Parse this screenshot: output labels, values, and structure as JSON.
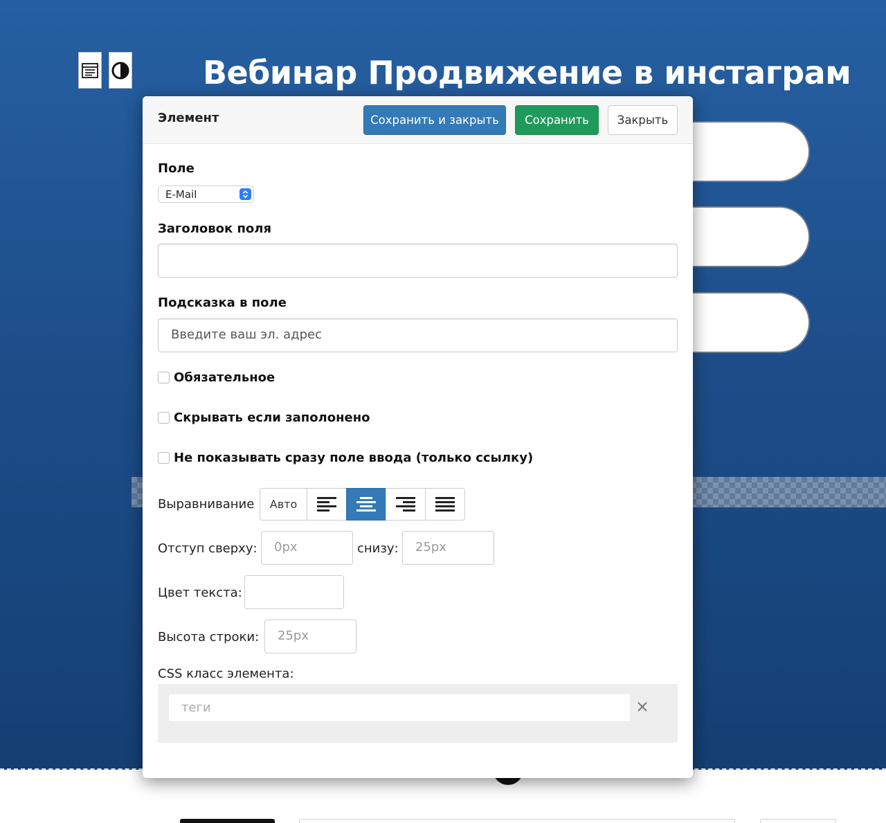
{
  "page": {
    "title": "Вебинар Продвижение в инстаграм"
  },
  "toolbar": {
    "left_icon": "form-list-icon",
    "right_icon": "contrast-icon"
  },
  "modal": {
    "title": "Элемент",
    "buttons": {
      "save_close": "Сохранить и закрыть",
      "save": "Сохранить",
      "close": "Закрыть"
    },
    "field": {
      "label": "Поле",
      "selected": "E-Mail"
    },
    "field_title": {
      "label": "Заголовок поля",
      "value": ""
    },
    "field_hint": {
      "label": "Подсказка в поле",
      "value": "Введите ваш эл. адрес"
    },
    "checkboxes": [
      {
        "label": "Обязательное",
        "checked": false
      },
      {
        "label": "Скрывать если заполонено",
        "checked": false
      },
      {
        "label": "Не показывать сразу поле ввода (только ссылку)",
        "checked": false
      }
    ],
    "alignment": {
      "label": "Выравнивание",
      "auto_label": "Авто",
      "options": [
        "align-left-icon",
        "align-center-icon",
        "align-right-icon",
        "align-justify-icon"
      ],
      "selected": "align-center-icon"
    },
    "spacing": {
      "top_label": "Отступ сверху:",
      "top_placeholder": "0px",
      "bottom_label": "снизу:",
      "bottom_placeholder": "25px"
    },
    "text_color": {
      "label": "Цвет текста:",
      "value": ""
    },
    "line_height": {
      "label": "Высота строки:",
      "placeholder": "25px"
    },
    "css_class": {
      "label": "CSS класс элемента:",
      "placeholder": "теги"
    }
  },
  "colors": {
    "primary": "#337ab7",
    "success": "#1f9a5b",
    "background": "#1d4e8a"
  }
}
